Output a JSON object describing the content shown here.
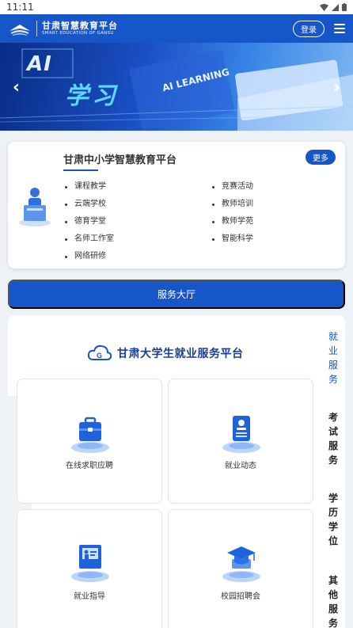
{
  "status_bar": {
    "time": "11:11"
  },
  "header": {
    "brand_cn": "甘肃智慧教育平台",
    "brand_en": "SMART EDUCATION OF GANSU",
    "login_label": "登录",
    "accent": "#1756c9"
  },
  "banner": {
    "ai_text": "AI",
    "study_text": "学习",
    "learning_text": "AI LEARNING",
    "prev_icon": "chevron-left-icon",
    "next_icon": "chevron-right-icon"
  },
  "platform": {
    "title": "甘肃中小学智慧教育平台",
    "more_label": "更多",
    "links_left": [
      "课程教学",
      "云端学校",
      "德育学堂",
      "名师工作室",
      "网络研修"
    ],
    "links_right": [
      "竞赛活动",
      "教师培训",
      "教师学苑",
      "智能科学"
    ]
  },
  "service_hall": {
    "label": "服务大厅"
  },
  "employment": {
    "title": "甘肃大学生就业服务平台",
    "tiles": [
      {
        "label": "在线求职应聘",
        "icon": "briefcase-icon"
      },
      {
        "label": "就业动态",
        "icon": "document-user-icon"
      },
      {
        "label": "就业指导",
        "icon": "presentation-icon"
      },
      {
        "label": "校园招聘会",
        "icon": "graduation-cap-icon"
      }
    ],
    "side_tabs": [
      {
        "label": "就业服务"
      },
      {
        "label": "考试服务"
      },
      {
        "label": "学历学位"
      },
      {
        "label": "其他服务"
      }
    ]
  }
}
